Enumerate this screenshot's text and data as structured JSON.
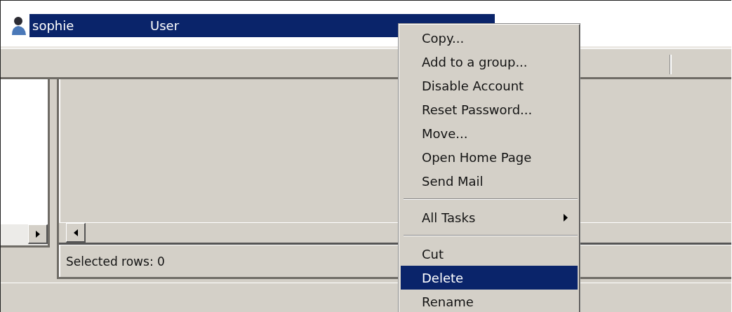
{
  "list": {
    "rows": [
      {
        "name": "sophie",
        "type": "User",
        "selected": true
      }
    ]
  },
  "status_bar": {
    "text": "Selected rows: 0"
  },
  "context_menu": {
    "items": [
      {
        "kind": "item",
        "label": "Copy...",
        "selected": false
      },
      {
        "kind": "item",
        "label": "Add to a group...",
        "selected": false
      },
      {
        "kind": "item",
        "label": "Disable Account",
        "selected": false
      },
      {
        "kind": "item",
        "label": "Reset Password...",
        "selected": false
      },
      {
        "kind": "item",
        "label": "Move...",
        "selected": false
      },
      {
        "kind": "item",
        "label": "Open Home Page",
        "selected": false
      },
      {
        "kind": "item",
        "label": "Send Mail",
        "selected": false
      },
      {
        "kind": "separator"
      },
      {
        "kind": "submenu",
        "label": "All Tasks",
        "selected": false
      },
      {
        "kind": "separator"
      },
      {
        "kind": "item",
        "label": "Cut",
        "selected": false
      },
      {
        "kind": "item",
        "label": "Delete",
        "selected": true
      },
      {
        "kind": "item",
        "label": "Rename",
        "selected": false
      }
    ]
  }
}
